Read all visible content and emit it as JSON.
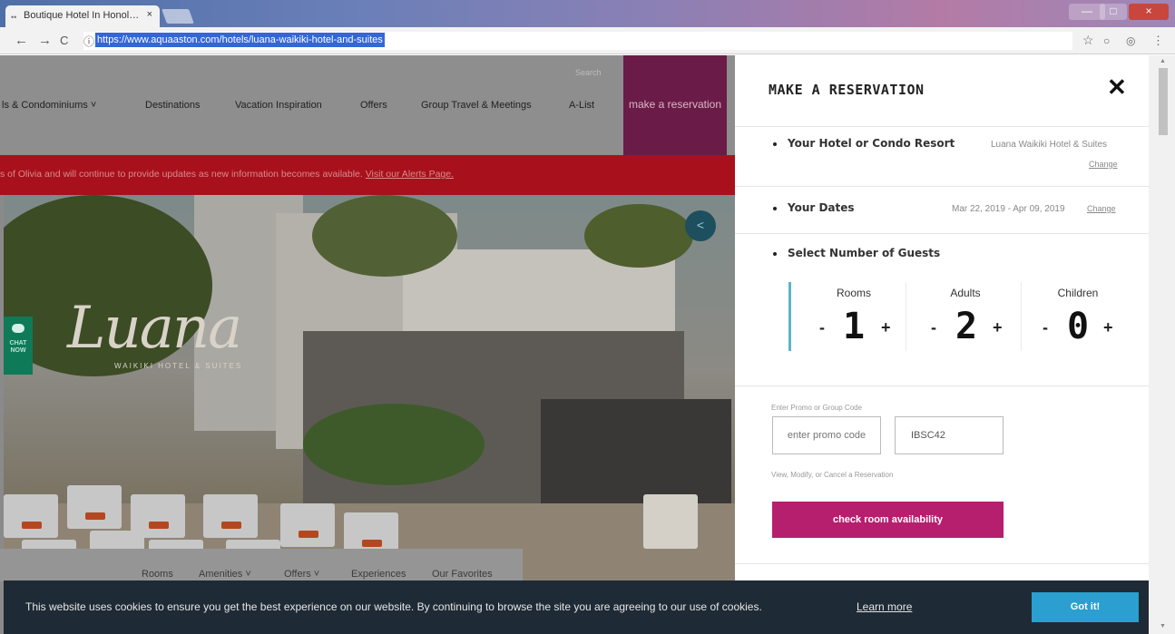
{
  "browser": {
    "tab_title": "Boutique Hotel In Honol…",
    "tab_close": "×",
    "url": "https://www.aquaaston.com/hotels/luana-waikiki-hotel-and-suites",
    "back": "←",
    "forward": "→",
    "reload": "C",
    "info": "ⓘ",
    "star": "☆",
    "menu": "⋮",
    "win_min": "—",
    "win_max": "□",
    "win_close": "×"
  },
  "site": {
    "nav": {
      "items": [
        "ls & Condominiums  ˅",
        "Destinations",
        "Vacation Inspiration",
        "Offers",
        "Group Travel & Meetings",
        "A-List"
      ],
      "search_label": "Search",
      "make_reservation": "make a reservation"
    },
    "alert": {
      "text": "s of Olivia and will continue to provide updates as new information becomes available. ",
      "link": "Visit our Alerts Page."
    },
    "hero": {
      "logo": "Luana",
      "logo_sub": "WAIKIKI HOTEL & SUITES",
      "share_icon": "<",
      "chat_label": "CHAT NOW"
    },
    "subnav": [
      "Rooms",
      "Amenities ˅",
      "Offers ˅",
      "Experiences",
      "Our Favorites"
    ]
  },
  "panel": {
    "title": "MAKE A RESERVATION",
    "close": "✕",
    "hotel": {
      "label": "Your Hotel or Condo Resort",
      "value": "Luana Waikiki Hotel & Suites",
      "change": "Change"
    },
    "dates": {
      "label": "Your Dates",
      "value": "Mar 22, 2019 - Apr 09, 2019",
      "change": "Change"
    },
    "guests": {
      "label": "Select Number of Guests",
      "columns": [
        {
          "label": "Rooms",
          "value": "1",
          "minus": "-",
          "plus": "+"
        },
        {
          "label": "Adults",
          "value": "2",
          "minus": "-",
          "plus": "+"
        },
        {
          "label": "Children",
          "value": "0",
          "minus": "-",
          "plus": "+"
        }
      ]
    },
    "promo": {
      "label": "Enter Promo or Group Code",
      "promo_placeholder": "enter promo code",
      "group_value": "IBSC42"
    },
    "manage_link": "View, Modify, or Cancel a Reservation",
    "check_button": "check room availability"
  },
  "cookie": {
    "text": "This website uses cookies to ensure you get the best experience on our website. By continuing to browse the site you are agreeing to our use of cookies.",
    "learn_more": "Learn more",
    "ok": "Got it!"
  },
  "colors": {
    "reservation_purple": "#6b1b48",
    "check_button": "#b51f6e",
    "alert_red": "#a8111b",
    "cookie_bg": "#1e2a35",
    "cookie_button": "#2a9fd0",
    "accent_teal": "#5bb5c6"
  }
}
